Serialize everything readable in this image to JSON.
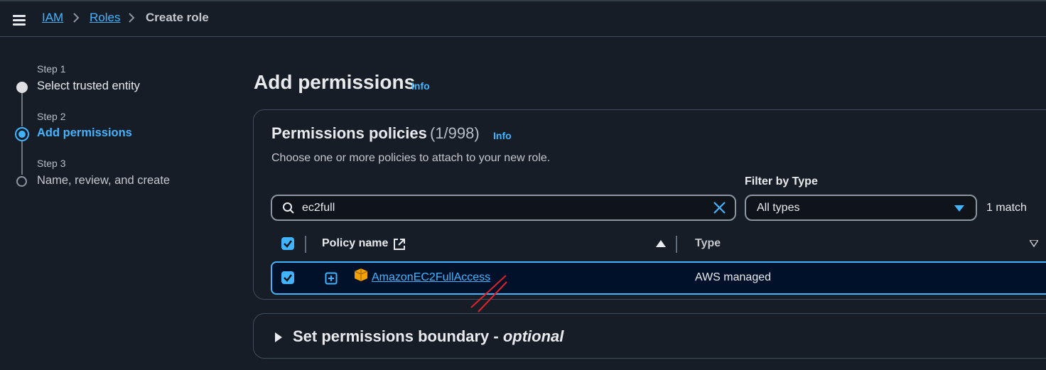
{
  "breadcrumb": {
    "iam": "IAM",
    "roles": "Roles",
    "current": "Create role"
  },
  "steps": [
    {
      "label": "Step 1",
      "title": "Select trusted entity",
      "state": "completed"
    },
    {
      "label": "Step 2",
      "title": "Add permissions",
      "state": "active"
    },
    {
      "label": "Step 3",
      "title": "Name, review, and create",
      "state": "pending"
    }
  ],
  "page": {
    "title": "Add permissions",
    "info": "Info"
  },
  "policies": {
    "title": "Permissions policies",
    "count": "(1/998)",
    "info": "Info",
    "description": "Choose one or more policies to attach to your new role.",
    "filter_label": "Filter by Type",
    "search_value": "ec2full",
    "filter_value": "All types",
    "match_text": "1 match",
    "columns": {
      "policy_name": "Policy name",
      "type": "Type"
    },
    "rows": [
      {
        "name": "AmazonEC2FullAccess",
        "type": "AWS managed",
        "selected": true
      }
    ]
  },
  "boundary": {
    "title": "Set permissions boundary - ",
    "optional": "optional"
  },
  "colors": {
    "accent": "#42b4ff",
    "background": "#161d26",
    "annotation": "#e0222a",
    "policy_icon": "#f2a300"
  },
  "icons": [
    "menu-icon",
    "chevron-right-icon",
    "search-icon",
    "clear-icon",
    "caret-down-icon",
    "external-link-icon",
    "sort-ascending-icon",
    "expand-icon",
    "policy-icon",
    "triangle-right-icon"
  ]
}
